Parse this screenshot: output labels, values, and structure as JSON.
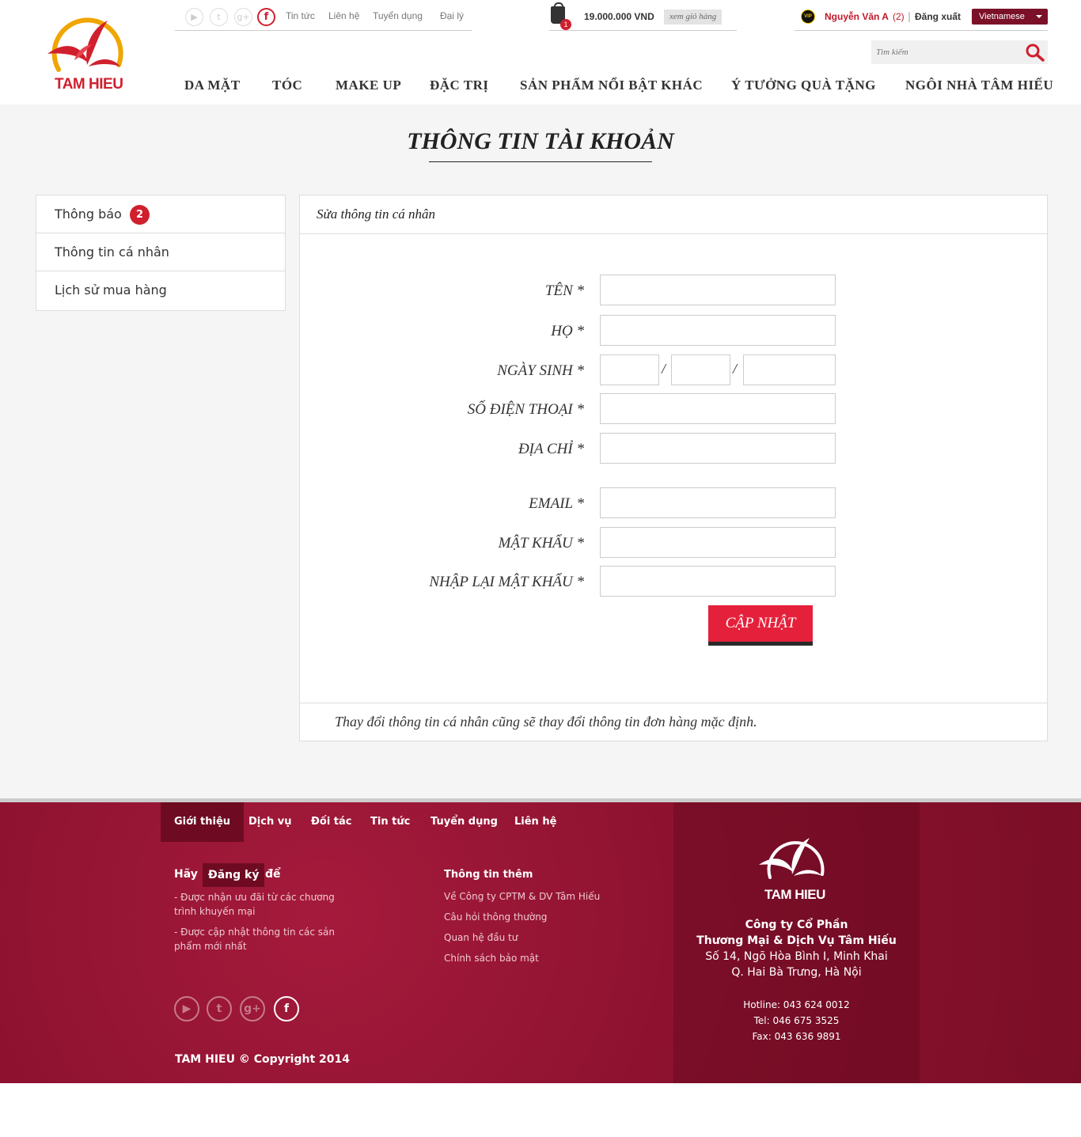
{
  "header": {
    "logo_text": "TAM HIEU",
    "top_links": [
      "Tin tức",
      "Liên hệ",
      "Tuyển dụng",
      "Đại lý"
    ],
    "cart": {
      "count": "1",
      "total": "19.000.000 VND",
      "view_label": "xem giỏ hàng"
    },
    "user": {
      "vip": "VIP",
      "name": "Nguyễn Văn A",
      "count": "(2)",
      "separator": "|",
      "logout": "Đăng xuất"
    },
    "language": "Vietnamese",
    "search_placeholder": "Tìm kiếm",
    "nav": [
      "DA MẶT",
      "TÓC",
      "MAKE UP",
      "ĐẶC TRỊ",
      "SẢN PHẨM NỔI BẬT KHÁC",
      "Ý TƯỞNG QUÀ TẶNG",
      "NGÔI NHÀ TÂM HIẾU"
    ]
  },
  "page": {
    "title": "THÔNG TIN TÀI KHOẢN",
    "sidebar": [
      {
        "label": "Thông báo",
        "badge": "2"
      },
      {
        "label": "Thông tin cá nhân"
      },
      {
        "label": "Lịch sử mua hàng"
      }
    ],
    "panel": {
      "heading": "Sửa thông tin cá nhân",
      "fields": {
        "ten": "TÊN *",
        "ho": "HỌ *",
        "ngay_sinh": "NGÀY SINH *",
        "sdt": "SỐ ĐIỆN THOẠI *",
        "dia_chi": "ĐỊA CHỈ *",
        "email": "EMAIL *",
        "mat_khau": "MẬT KHẨU *",
        "nhap_lai": "NHẬP LẠI MẬT KHẨU *"
      },
      "date_sep": "/",
      "submit": "CẬP NHẬT",
      "note": "Thay đổi thông tin cá nhân cũng sẽ thay đổi thông tin đơn hàng mặc định."
    }
  },
  "footer": {
    "nav": [
      "Giới thiệu",
      "Dịch vụ",
      "Đối tác",
      "Tin tức",
      "Tuyển dụng",
      "Liên hệ"
    ],
    "register": {
      "pre": "Hãy",
      "highlight": "Đăng ký",
      "post": "để"
    },
    "benefits": [
      "- Được nhận ưu đãi từ các chương trình khuyến mại",
      "- Được cập nhật thông tin các sản phẩm mới nhất"
    ],
    "more_title": "Thông tin thêm",
    "more_links": [
      "Về Công ty CPTM & DV Tâm Hiếu",
      "Câu hỏi thông thường",
      "Quan hệ đầu tư",
      "Chính sách bảo mật"
    ],
    "copyright": "TAM HIEU © Copyright 2014",
    "logo_text": "TAM HIEU",
    "company": [
      "Công ty Cổ Phần",
      "Thương Mại & Dịch Vụ Tâm Hiếu",
      "Số 14, Ngõ Hòa Bình I, Minh Khai",
      "Q. Hai Bà Trưng, Hà Nội"
    ],
    "contacts": [
      "Hotline: 043 624 0012",
      "Tel: 046 675 3525",
      "Fax: 043 636 9891"
    ]
  },
  "colors": {
    "brand_red": "#d0202e",
    "maroon": "#8e1230",
    "button": "#e5203b"
  },
  "icons": [
    "youtube-icon",
    "twitter-icon",
    "google-plus-icon",
    "facebook-icon",
    "cart-icon",
    "vip-icon",
    "search-icon"
  ]
}
